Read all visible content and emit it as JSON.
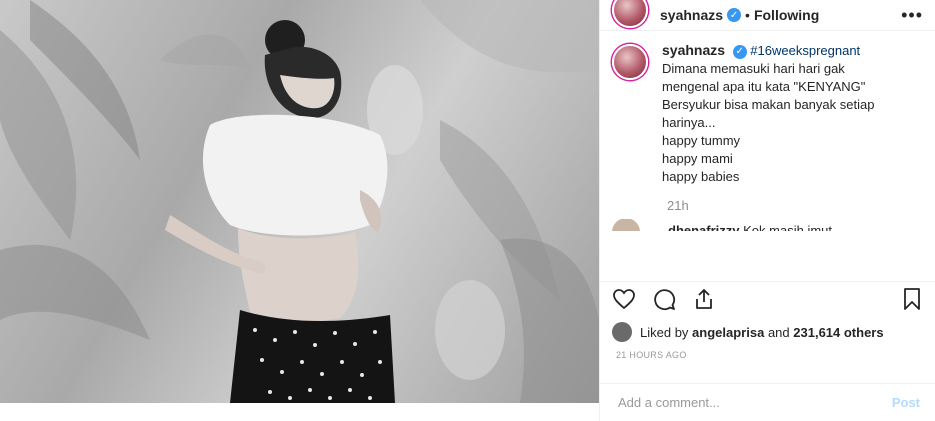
{
  "post": {
    "username": "syahnazs",
    "follow_separator": "•",
    "follow_label": "Following",
    "more_label": "•••"
  },
  "caption": {
    "username": "syahnazs",
    "hashtag": "#16weekspregnant",
    "lines": [
      "Dimana memasuki hari hari gak",
      "mengenal apa itu kata \"KENYANG\"",
      "Bersyukur bisa makan banyak setiap",
      "harinya...",
      "happy tummy",
      "happy mami",
      "happy babies"
    ],
    "time": "21h"
  },
  "comment": {
    "username": "dhenafrizzy",
    "text": "Kok masih imut"
  },
  "likes": {
    "prefix": "Liked by",
    "user": "angelaprisa",
    "connector": "and",
    "count": "231,614 others"
  },
  "timestamp": "21 HOURS AGO",
  "composer": {
    "placeholder": "Add a comment...",
    "post_label": "Post"
  },
  "icons": {
    "like": "heart-icon",
    "comment": "comment-icon",
    "share": "share-icon",
    "save": "bookmark-icon",
    "verified": "verified-badge-icon"
  },
  "colors": {
    "accent": "#3897f0",
    "hashtag": "#003569",
    "post_disabled": "#b3dbff",
    "muted": "#8e8e8e"
  }
}
